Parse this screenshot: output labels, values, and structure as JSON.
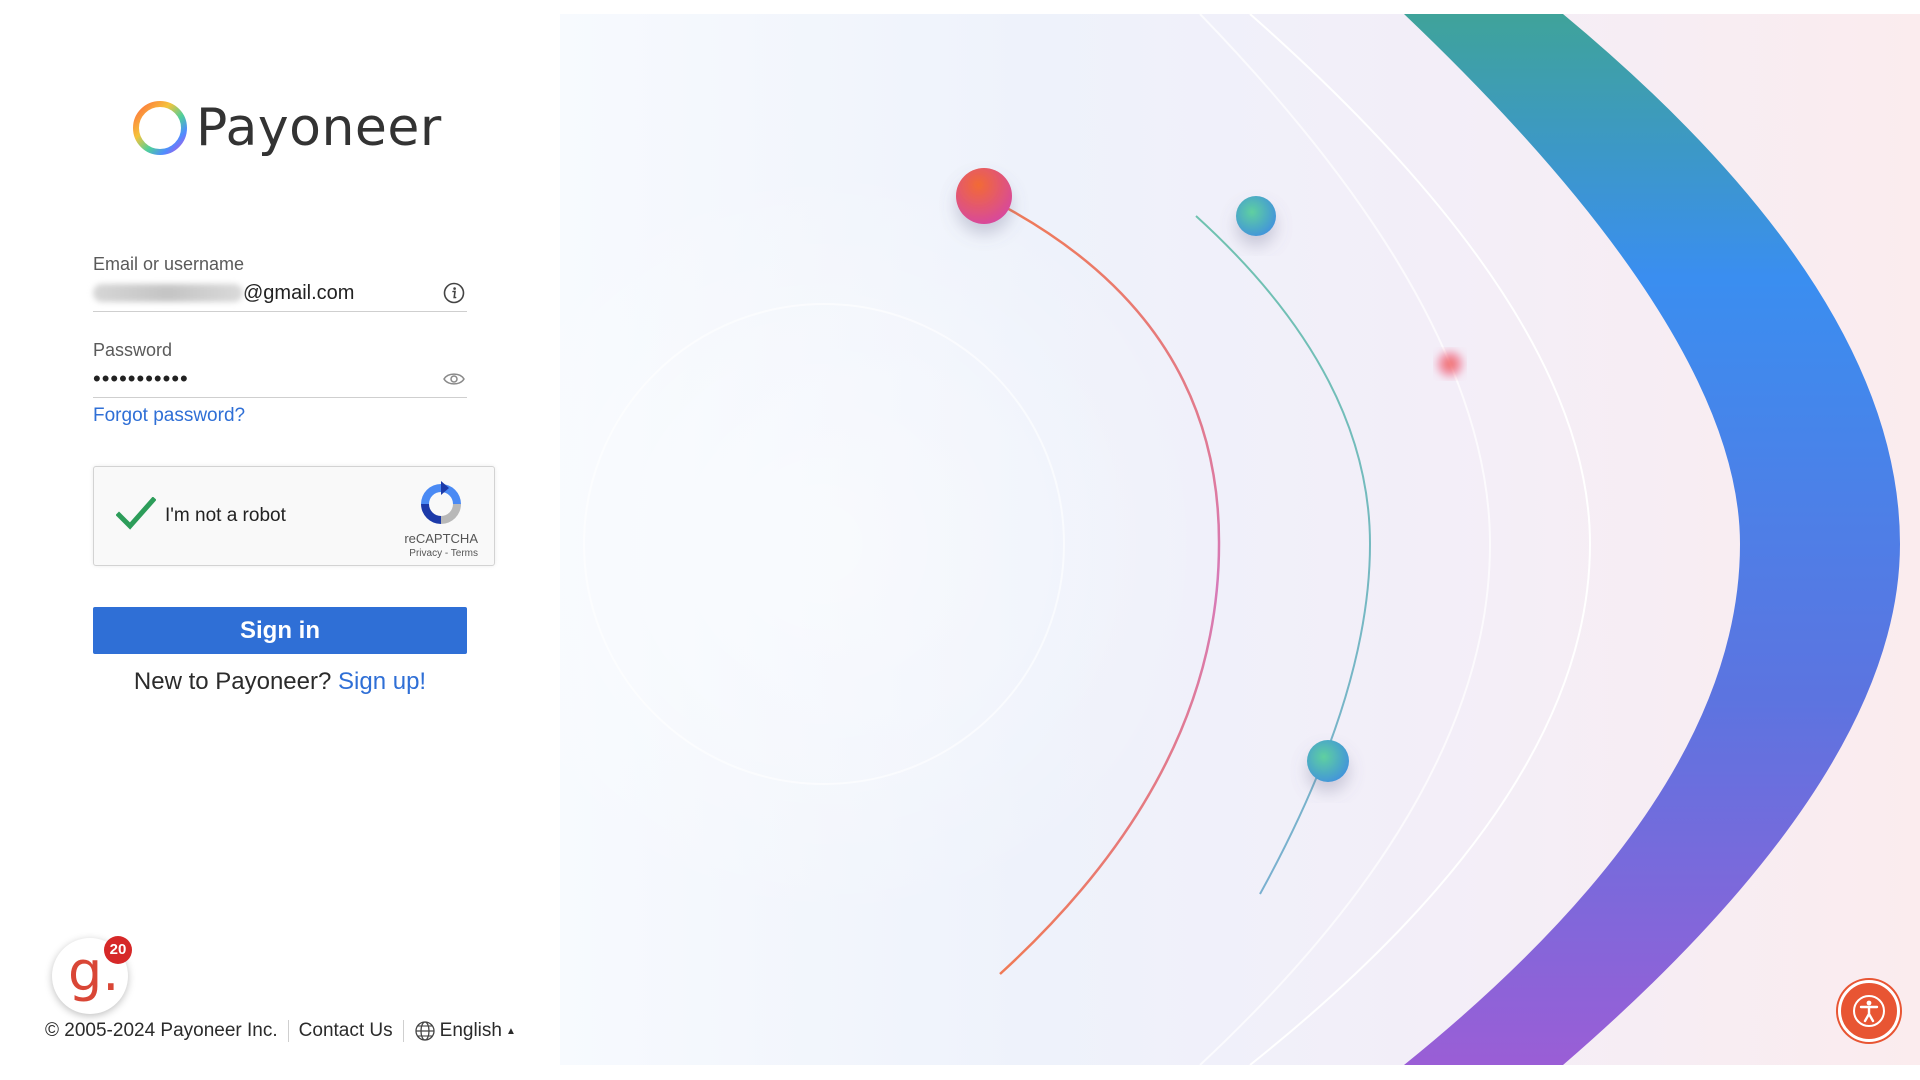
{
  "brand": {
    "name": "Payoneer"
  },
  "form": {
    "email_label": "Email or username",
    "email_masked": "redacted-user",
    "email_domain": "@gmail.com",
    "password_label": "Password",
    "password_value": "•••••••••••",
    "forgot_link": "Forgot password?",
    "signin_button": "Sign in",
    "new_prompt": "New to Payoneer?",
    "signup_link": "Sign up!"
  },
  "recaptcha": {
    "label": "I'm not a robot",
    "brand": "reCAPTCHA",
    "links": "Privacy - Terms",
    "checked": true
  },
  "g2_badge": {
    "letter": "g.",
    "count": "20"
  },
  "footer": {
    "copyright": "© 2005-2024 Payoneer Inc.",
    "contact": "Contact Us",
    "language": "English"
  },
  "colors": {
    "primary": "#2f6fd6",
    "link": "#2f6fd6",
    "accessibility": "#e85533",
    "g2": "#d94636"
  },
  "icons": [
    "payoneer-logo-icon",
    "info-icon",
    "eye-icon",
    "checkmark-icon",
    "recaptcha-icon",
    "globe-icon",
    "accessibility-icon"
  ]
}
